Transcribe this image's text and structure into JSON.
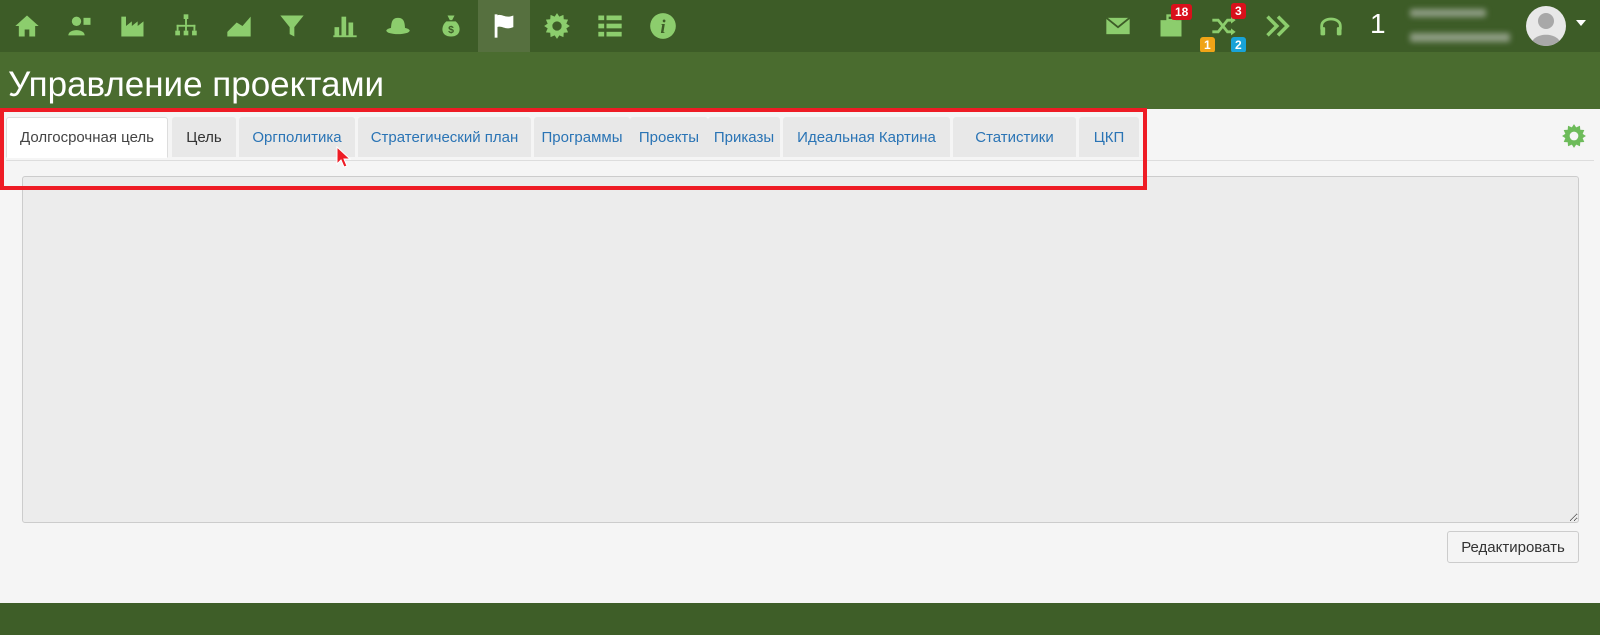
{
  "topbar": {
    "nav_icons": [
      "home-icon",
      "users-icon",
      "factory-icon",
      "org-chart-icon",
      "area-chart-icon",
      "funnel-icon",
      "bar-chart-icon",
      "hat-icon",
      "money-bag-icon",
      "flag-icon",
      "gear-icon",
      "list-icon",
      "info-icon"
    ],
    "active_icon": "flag-icon",
    "icon_color": "#8ccd6d",
    "badges": {
      "briefcase_red": "18",
      "briefcase_orange": "1",
      "shuffle_red": "3",
      "shuffle_blue": "2"
    },
    "counter": "1"
  },
  "page": {
    "title": "Управление проектами"
  },
  "tabs": [
    {
      "label": "Долгосрочная цель",
      "active": true
    },
    {
      "label": "Цель"
    },
    {
      "label": "Оргполитика"
    },
    {
      "label": "Стратегический план"
    },
    {
      "label": "Программы"
    },
    {
      "label": "Проекты"
    },
    {
      "label": "Приказы"
    },
    {
      "label": "Идеальная Картина"
    },
    {
      "label": "Статистики"
    },
    {
      "label": "ЦКП"
    }
  ],
  "actions": {
    "edit_label": "Редактировать"
  },
  "colors": {
    "topbar": "#3d5c27",
    "title_band": "#4a6c2f",
    "link": "#2a74b5",
    "highlight": "#ee1c25"
  }
}
